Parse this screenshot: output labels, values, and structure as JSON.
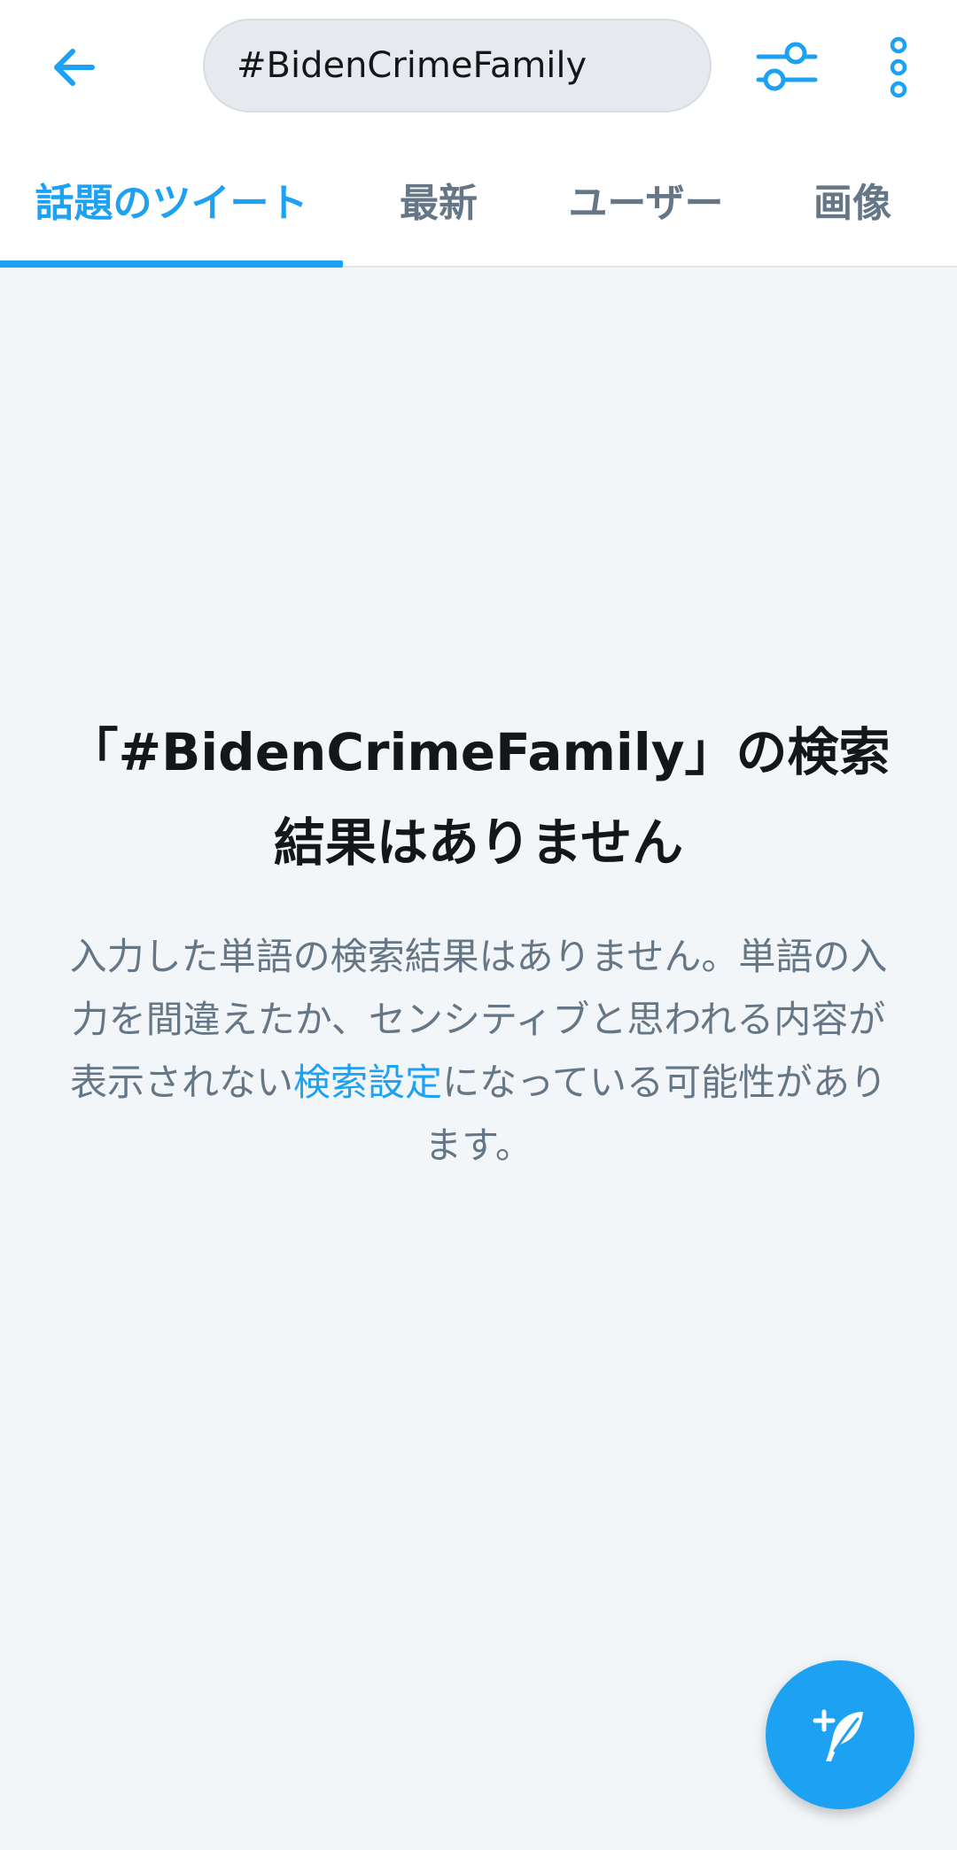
{
  "search": {
    "query": "#BidenCrimeFamily"
  },
  "tabs": [
    {
      "label": "話題のツイート"
    },
    {
      "label": "最新"
    },
    {
      "label": "ユーザー"
    },
    {
      "label": "画像"
    }
  ],
  "empty_state": {
    "title": "「#BidenCrimeFamily」の検索結果はありません",
    "body_before_link": "入力した単語の検索結果はありません。単語の入力を間違えたか、センシティブと思われる内容が表示されない",
    "link_text": "検索設定",
    "body_after_link": "になっている可能性があります。"
  },
  "icons": {
    "back": "arrow-left-icon",
    "filter": "sliders-icon",
    "more": "more-vertical-icon",
    "compose": "compose-tweet-icon"
  },
  "colors": {
    "accent": "#1da1f2",
    "background": "#f3f6f9",
    "text_primary": "#14171a",
    "text_secondary": "#657786"
  }
}
